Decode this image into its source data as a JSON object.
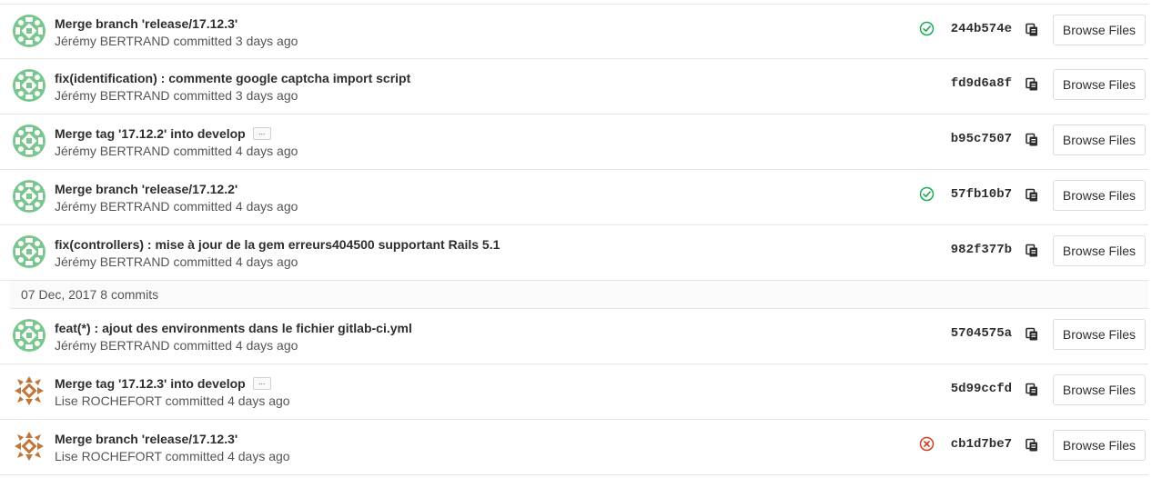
{
  "browse_label": "Browse Files",
  "commits_top": [
    {
      "title": "Merge branch 'release/17.12.3'",
      "author": "Jérémy BERTRAND",
      "action": "committed",
      "time": "3 days ago",
      "sha": "244b574e",
      "status": "success",
      "has_ellipsis": false,
      "avatar": "green"
    },
    {
      "title": "fix(identification) : commente google captcha import script",
      "author": "Jérémy BERTRAND",
      "action": "committed",
      "time": "3 days ago",
      "sha": "fd9d6a8f",
      "status": "none",
      "has_ellipsis": false,
      "avatar": "green"
    },
    {
      "title": "Merge tag '17.12.2' into develop",
      "author": "Jérémy BERTRAND",
      "action": "committed",
      "time": "4 days ago",
      "sha": "b95c7507",
      "status": "none",
      "has_ellipsis": true,
      "avatar": "green"
    },
    {
      "title": "Merge branch 'release/17.12.2'",
      "author": "Jérémy BERTRAND",
      "action": "committed",
      "time": "4 days ago",
      "sha": "57fb10b7",
      "status": "success",
      "has_ellipsis": false,
      "avatar": "green"
    },
    {
      "title": "fix(controllers) : mise à jour de la gem erreurs404500 supportant Rails 5.1",
      "author": "Jérémy BERTRAND",
      "action": "committed",
      "time": "4 days ago",
      "sha": "982f377b",
      "status": "none",
      "has_ellipsis": false,
      "avatar": "green"
    }
  ],
  "day_group": {
    "date": "07 Dec, 2017",
    "count": "8 commits"
  },
  "commits_bottom": [
    {
      "title": "feat(*) : ajout des environments dans le fichier gitlab-ci.yml",
      "author": "Jérémy BERTRAND",
      "action": "committed",
      "time": "4 days ago",
      "sha": "5704575a",
      "status": "none",
      "has_ellipsis": false,
      "avatar": "green"
    },
    {
      "title": "Merge tag '17.12.3' into develop",
      "author": "Lise ROCHEFORT",
      "action": "committed",
      "time": "4 days ago",
      "sha": "5d99ccfd",
      "status": "none",
      "has_ellipsis": true,
      "avatar": "brown"
    },
    {
      "title": "Merge branch 'release/17.12.3'",
      "author": "Lise ROCHEFORT",
      "action": "committed",
      "time": "4 days ago",
      "sha": "cb1d7be7",
      "status": "failed",
      "has_ellipsis": false,
      "avatar": "brown"
    }
  ],
  "ellipsis_label": "...",
  "colors": {
    "success": "#1aaa55",
    "failed": "#db3b21",
    "avatar_green": "#7ac68f",
    "avatar_brown": "#c0763a"
  },
  "icons": {
    "status_success": "check-circle-icon",
    "status_failed": "x-circle-icon",
    "copy": "clipboard-icon"
  }
}
